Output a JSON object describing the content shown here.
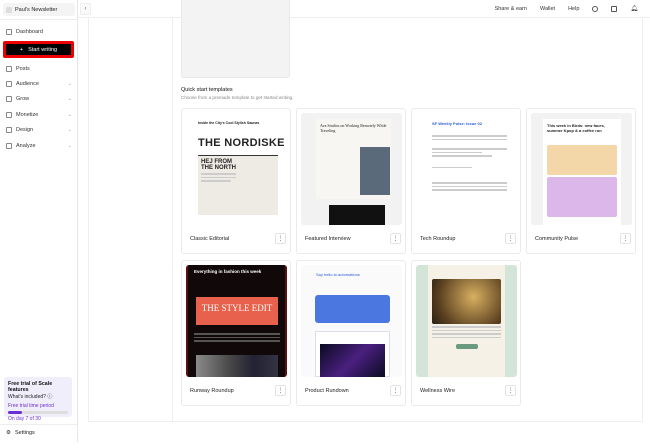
{
  "sidebar": {
    "publication": "Paul's Newsletter",
    "dashboard": "Dashboard",
    "start_writing": "Start writing",
    "items": [
      {
        "label": "Posts",
        "icon": "file-icon"
      },
      {
        "label": "Audience",
        "icon": "users-icon"
      },
      {
        "label": "Grow",
        "icon": "trend-icon"
      },
      {
        "label": "Monetize",
        "icon": "money-icon"
      },
      {
        "label": "Design",
        "icon": "palette-icon"
      },
      {
        "label": "Analyze",
        "icon": "chart-icon"
      }
    ],
    "trial": {
      "title": "Free trial of Scale features",
      "included": "What's included?",
      "period_label": "Free trial time period",
      "progress": 0.23,
      "status": "On day 7 of 30"
    },
    "settings": "Settings"
  },
  "topbar": {
    "share": "Share & earn",
    "wallet": "Wallet",
    "help": "Help"
  },
  "templates": {
    "title": "Quick start templates",
    "subtitle": "Choose from a premade template to get started writing.",
    "items": [
      {
        "name": "Classic Editorial",
        "t1": "Inside the City's Cool Stylish Saunas",
        "t2": "THE NORDISKE",
        "t3": "HEJ FROM THE NORTH"
      },
      {
        "name": "Featured Interview",
        "t1": "Ava Studios on Working Remotely While Traveling"
      },
      {
        "name": "Tech Roundup",
        "t1": "SF Weekly Pulse: Issue 02"
      },
      {
        "name": "Community Pulse",
        "t1": "This week in Birds: new faces, summer Kpop & a coffee run"
      },
      {
        "name": "Runway Roundup",
        "t1": "Everything in fashion this week",
        "t2": "THE STYLE EDIT"
      },
      {
        "name": "Product Rundown",
        "t1": "Say hello to automations"
      },
      {
        "name": "Wellness Wire"
      }
    ]
  },
  "colors": {
    "accent": "#6b2fd1",
    "highlight": "#e00000"
  }
}
